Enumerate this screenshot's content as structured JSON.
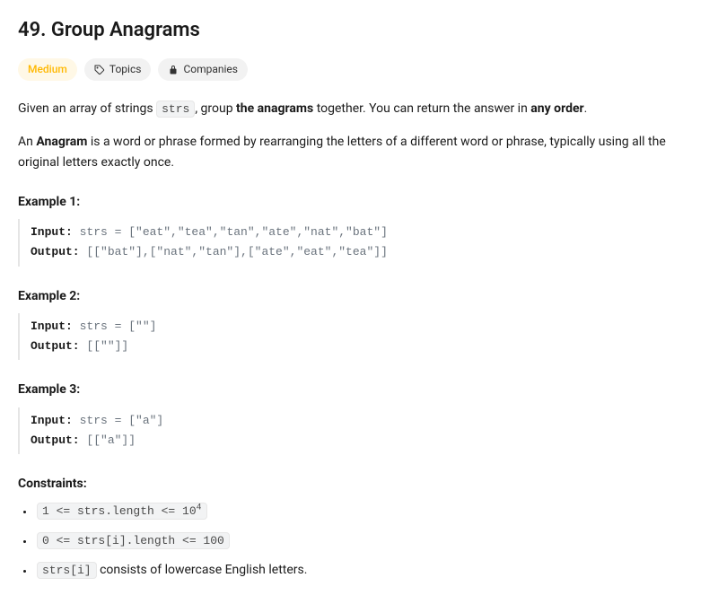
{
  "title": "49. Group Anagrams",
  "pills": {
    "difficulty": "Medium",
    "topics": "Topics",
    "companies": "Companies"
  },
  "desc": {
    "p1a": "Given an array of strings ",
    "p1code": "strs",
    "p1b": ", group ",
    "p1bold1": "the anagrams",
    "p1c": " together. You can return the answer in ",
    "p1bold2": "any order",
    "p1d": ".",
    "p2a": "An ",
    "p2bold": "Anagram",
    "p2b": " is a word or phrase formed by rearranging the letters of a different word or phrase, typically using all the original letters exactly once."
  },
  "examples": [
    {
      "label": "Example 1:",
      "input_label": "Input:",
      "input_value": " strs = [\"eat\",\"tea\",\"tan\",\"ate\",\"nat\",\"bat\"]",
      "output_label": "Output:",
      "output_value": " [[\"bat\"],[\"nat\",\"tan\"],[\"ate\",\"eat\",\"tea\"]]"
    },
    {
      "label": "Example 2:",
      "input_label": "Input:",
      "input_value": " strs = [\"\"]",
      "output_label": "Output:",
      "output_value": " [[\"\"]]"
    },
    {
      "label": "Example 3:",
      "input_label": "Input:",
      "input_value": " strs = [\"a\"]",
      "output_label": "Output:",
      "output_value": " [[\"a\"]]"
    }
  ],
  "constraints_label": "Constraints:",
  "constraints": [
    {
      "code": "1 <= strs.length <= 10",
      "sup": "4",
      "tail": ""
    },
    {
      "code": "0 <= strs[i].length <= 100",
      "sup": "",
      "tail": ""
    },
    {
      "code": "strs[i]",
      "sup": "",
      "tail": " consists of lowercase English letters."
    }
  ]
}
